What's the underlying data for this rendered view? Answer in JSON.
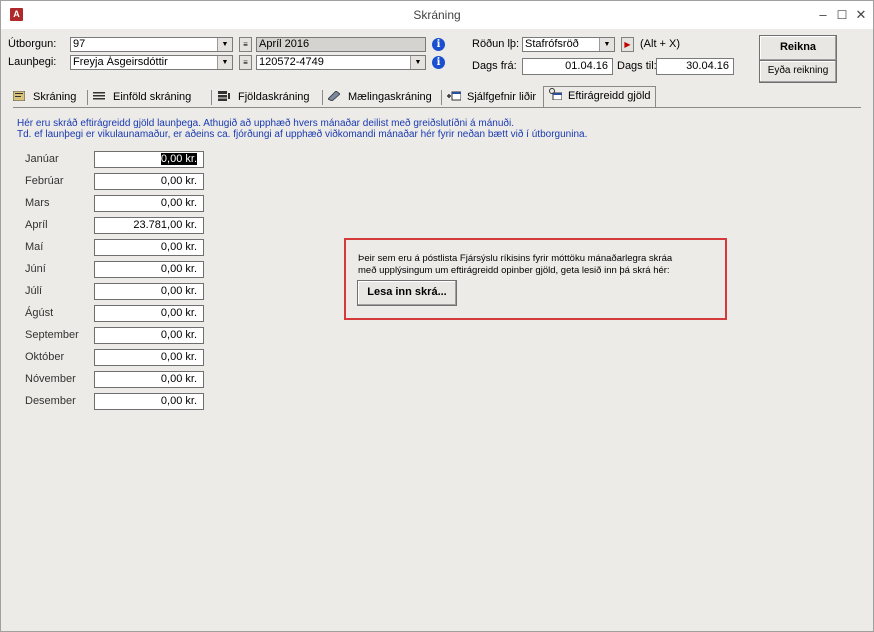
{
  "window": {
    "title": "Skráning",
    "app_icon": "access-app-icon"
  },
  "header": {
    "utborgun_label": "Útborgun:",
    "utborgun_value": "97",
    "period_value": "Apríl 2016",
    "launthegi_label": "Launþegi:",
    "launthegi_value": "Freyja Ásgeirsdóttir",
    "kennitala_value": "120572-4749",
    "rodun_label": "Röðun lþ:",
    "rodun_value": "Stafrófsröð",
    "shortcut_hint": "(Alt + X)",
    "dags_fra_label": "Dags frá:",
    "dags_fra_value": "01.04.16",
    "dags_til_label": "Dags til:",
    "dags_til_value": "30.04.16",
    "reikna_label": "Reikna",
    "eyda_label": "Eyða reikning"
  },
  "tabs": [
    {
      "label": "Skráning",
      "icon": "form-icon"
    },
    {
      "label": "Einföld skráning",
      "icon": "list-icon"
    },
    {
      "label": "Fjöldaskráning",
      "icon": "grid-icon"
    },
    {
      "label": "Mælingaskráning",
      "icon": "ruler-icon"
    },
    {
      "label": "Sjálfgefnir liðir",
      "icon": "default-items-icon"
    },
    {
      "label": "Eftirágreidd gjöld",
      "icon": "settings-icon",
      "active": true
    }
  ],
  "notes": {
    "line1": "Hér eru skráð eftirágreidd gjöld launþega.  Athugið að upphæð hvers mánaðar deilist með greiðslutíðni á mánuði.",
    "line2": "Td. ef launþegi er vikulaunamaður, er aðeins ca. fjórðungi af upphæð viðkomandi mánaðar hér fyrir neðan bætt við í útborgunina."
  },
  "months": [
    {
      "label": "Janúar",
      "value": "0,00 kr."
    },
    {
      "label": "Febrúar",
      "value": "0,00 kr."
    },
    {
      "label": "Mars",
      "value": "0,00 kr."
    },
    {
      "label": "Apríl",
      "value": "23.781,00 kr."
    },
    {
      "label": "Maí",
      "value": "0,00 kr."
    },
    {
      "label": "Júní",
      "value": "0,00 kr."
    },
    {
      "label": "Júlí",
      "value": "0,00 kr."
    },
    {
      "label": "Ágúst",
      "value": "0,00 kr."
    },
    {
      "label": "September",
      "value": "0,00 kr."
    },
    {
      "label": "Október",
      "value": "0,00 kr."
    },
    {
      "label": "Nóvember",
      "value": "0,00 kr."
    },
    {
      "label": "Desember",
      "value": "0,00 kr."
    }
  ],
  "import_box": {
    "line1": "Þeir sem eru á póstlista Fjársýslu ríkisins fyrir móttöku mánaðarlegra skráa",
    "line2": "með upplýsingum um eftirágreidd opinber gjöld, geta lesið inn þá skrá hér:",
    "button_label": "Lesa inn skrá..."
  },
  "colors": {
    "note_text": "#1a3ab0",
    "highlight_border": "#d43a3a",
    "info_icon": "#1a4fd0"
  }
}
